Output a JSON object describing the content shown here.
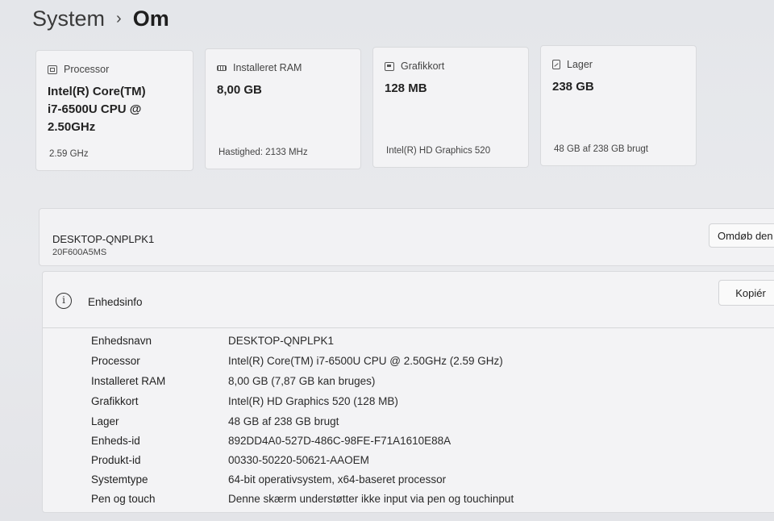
{
  "breadcrumb": {
    "parent": "System",
    "separator": "›",
    "current": "Om"
  },
  "cards": [
    {
      "label": "Processor",
      "icon": "processor-icon",
      "value_lines": [
        "Intel(R) Core(TM)",
        "i7-6500U CPU @",
        "2.50GHz"
      ],
      "sub": "2.59 GHz"
    },
    {
      "label": "Installeret RAM",
      "icon": "ram-icon",
      "value_lines": [
        "8,00 GB"
      ],
      "sub": "Hastighed: 2133 MHz"
    },
    {
      "label": "Grafikkort",
      "icon": "graphics-card-icon",
      "value_lines": [
        "128 MB"
      ],
      "sub": "Intel(R) HD Graphics 520"
    },
    {
      "label": "Lager",
      "icon": "storage-icon",
      "value_lines": [
        "238 GB"
      ],
      "sub": "48 GB af 238 GB brugt"
    }
  ],
  "device": {
    "name": "DESKTOP-QNPLPK1",
    "model": "20F600A5MS",
    "rename_button": "Omdøb den"
  },
  "device_info": {
    "icon": "info-icon",
    "title": "Enhedsinfo",
    "copy_button": "Kopiér",
    "specs": [
      {
        "label": "Enhedsnavn",
        "value": "DESKTOP-QNPLPK1"
      },
      {
        "label": "Processor",
        "value": "Intel(R) Core(TM) i7-6500U CPU @ 2.50GHz (2.59 GHz)"
      },
      {
        "label": "Installeret RAM",
        "value": "8,00 GB (7,87 GB kan bruges)"
      },
      {
        "label": "Grafikkort",
        "value": "Intel(R) HD Graphics 520 (128 MB)"
      },
      {
        "label": "Lager",
        "value": "48 GB af 238 GB brugt"
      },
      {
        "label": "Enheds-id",
        "value": "892DD4A0-527D-486C-98FE-F71A1610E88A"
      },
      {
        "label": "Produkt-id",
        "value": "00330-50220-50621-AAOEM"
      },
      {
        "label": "Systemtype",
        "value": "64-bit operativsystem, x64-baseret processor"
      },
      {
        "label": "Pen og touch",
        "value": "Denne skærm understøtter ikke input via pen og touchinput"
      }
    ]
  }
}
